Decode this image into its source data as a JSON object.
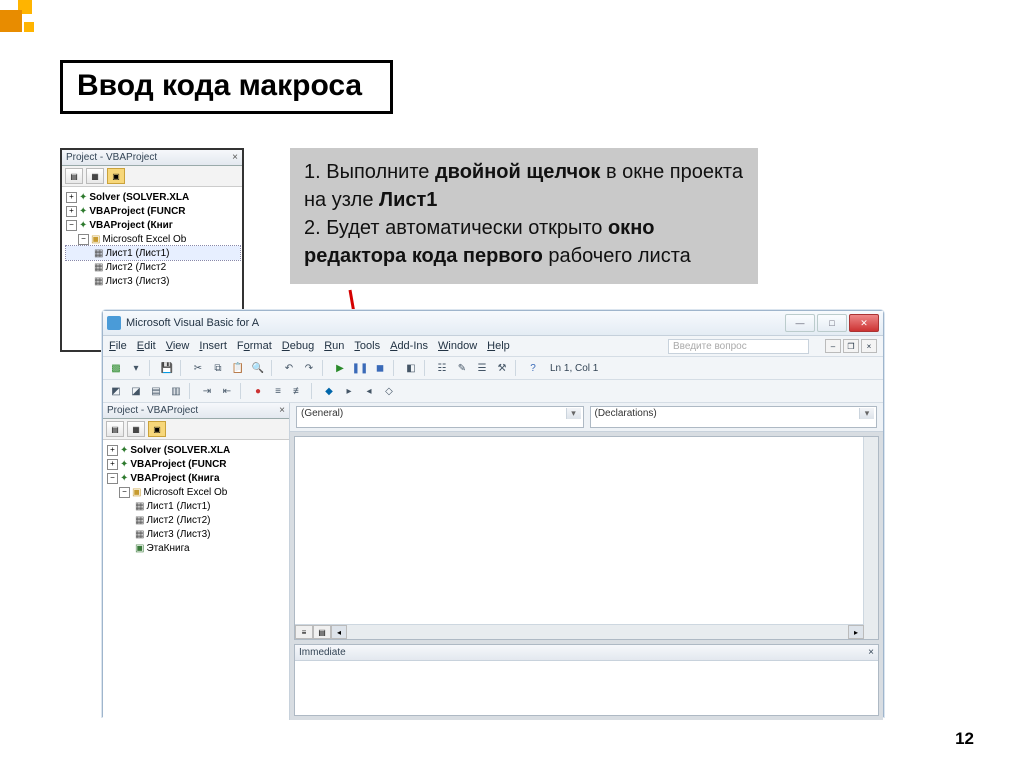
{
  "slide": {
    "title": "Ввод кода макроса",
    "page_number": "12"
  },
  "instruction": {
    "line1_a": "1. Выполните ",
    "line1_b": "двойной щелчок",
    "line1_c": " в окне проекта на узле ",
    "line1_d": "Лист1",
    "line2_a": "2. Будет автоматически открыто ",
    "line2_b": "окно редактора кода первого",
    "line2_c": " рабочего листа"
  },
  "panel1": {
    "title": "Project - VBAProject",
    "tree": {
      "solver": "Solver (SOLVER.XLA",
      "funcr": "VBAProject (FUNCR",
      "book": "VBAProject (Книг",
      "objects": "Microsoft Excel Ob",
      "s1": "Лист1 (Лист1)",
      "s2": "Лист2 (Лист2",
      "s3": "Лист3 (Лист3)"
    }
  },
  "vbe": {
    "title": "Microsoft Visual Basic for A",
    "menu": {
      "file": "File",
      "edit": "Edit",
      "view": "View",
      "insert": "Insert",
      "format": "Format",
      "debug": "Debug",
      "run": "Run",
      "tools": "Tools",
      "addins": "Add-Ins",
      "window": "Window",
      "help": "Help"
    },
    "help_search": "Введите вопрос",
    "position": "Ln 1, Col 1",
    "project_pane_title": "Project - VBAProject",
    "tree": {
      "solver": "Solver (SOLVER.XLA",
      "funcr": "VBAProject (FUNCR",
      "book": "VBAProject (Книга",
      "objects": "Microsoft Excel Ob",
      "s1": "Лист1 (Лист1)",
      "s2": "Лист2 (Лист2)",
      "s3": "Лист3 (Лист3)",
      "wb": "ЭтаКнига"
    },
    "dd_left": "(General)",
    "dd_right": "(Declarations)",
    "immediate_title": "Immediate"
  }
}
